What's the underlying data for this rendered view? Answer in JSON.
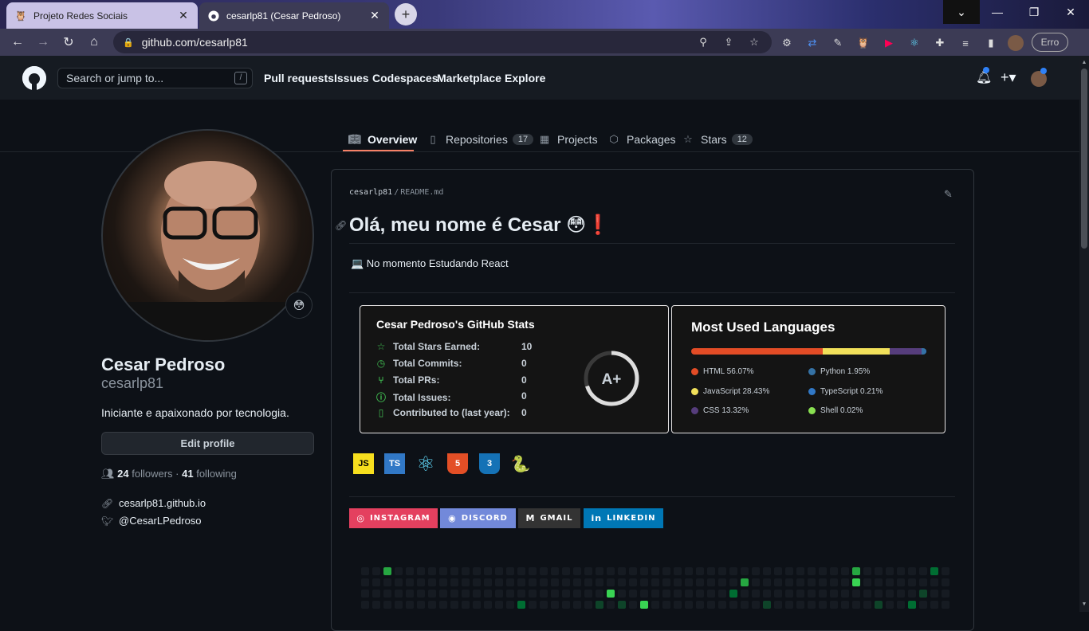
{
  "browser": {
    "tabs": [
      {
        "label": "Projeto Redes Sociais",
        "icon": "owl-icon"
      },
      {
        "label": "cesarlp81 (Cesar Pedroso)",
        "icon": "github-icon"
      }
    ],
    "url": "github.com/cesarlp81",
    "error_label": "Erro"
  },
  "header": {
    "search_placeholder": "Search or jump to...",
    "search_shortcut": "/",
    "nav": [
      "Pull requests",
      "Issues",
      "Codespaces",
      "Marketplace",
      "Explore"
    ]
  },
  "tabs": {
    "overview": "Overview",
    "repositories": "Repositories",
    "repositories_count": "17",
    "projects": "Projects",
    "packages": "Packages",
    "stars": "Stars",
    "stars_count": "12"
  },
  "profile": {
    "name": "Cesar Pedroso",
    "username": "cesarlp81",
    "bio": "Iniciante e apaixonado por tecnologia.",
    "edit_label": "Edit profile",
    "followers_count": "24",
    "followers_label": "followers",
    "separator": "·",
    "following_count": "41",
    "following_label": "following",
    "website": "cesarlp81.github.io",
    "twitter": "@CesarLPedroso"
  },
  "readme": {
    "path_user": "cesarlp81",
    "path_sep": "/",
    "path_file": "README.md",
    "heading": "Olá, meu nome é Cesar 😳❗",
    "now": "💻 No momento Estudando React"
  },
  "stats": {
    "title": "Cesar Pedroso's GitHub Stats",
    "rows": [
      {
        "label": "Total Stars Earned:",
        "value": "10"
      },
      {
        "label": "Total Commits:",
        "value": "0"
      },
      {
        "label": "Total PRs:",
        "value": "0"
      },
      {
        "label": "Total Issues:",
        "value": "0"
      },
      {
        "label": "Contributed to (last year):",
        "value": "0"
      }
    ],
    "grade": "A+",
    "grade_progress": 0.7,
    "accent": "#3fb950"
  },
  "languages": {
    "title": "Most Used Languages",
    "items": [
      {
        "label": "HTML 56.07%",
        "percent": 56.07,
        "color": "#e34c26"
      },
      {
        "label": "JavaScript 28.43%",
        "percent": 28.43,
        "color": "#f1e05a"
      },
      {
        "label": "CSS 13.32%",
        "percent": 13.32,
        "color": "#563d7c"
      },
      {
        "label": "Python 1.95%",
        "percent": 1.95,
        "color": "#3572a5"
      },
      {
        "label": "TypeScript 0.21%",
        "percent": 0.21,
        "color": "#3178c6"
      },
      {
        "label": "Shell 0.02%",
        "percent": 0.02,
        "color": "#89e051"
      }
    ]
  },
  "tech": [
    {
      "label": "JS",
      "icon": "javascript-icon",
      "bg": "#f7df1e",
      "fg": "#000000"
    },
    {
      "label": "TS",
      "icon": "typescript-icon",
      "bg": "#3178c6",
      "fg": "#ffffff"
    },
    {
      "label": "⚛",
      "icon": "react-icon",
      "bg": "transparent",
      "fg": "#61dafb"
    },
    {
      "label": "5",
      "icon": "html5-icon",
      "bg": "#e34f26",
      "fg": "#ffffff"
    },
    {
      "label": "3",
      "icon": "css3-icon",
      "bg": "#1572b6",
      "fg": "#ffffff"
    },
    {
      "label": "🐍",
      "icon": "python-icon",
      "bg": "transparent",
      "fg": "#ffd43b"
    }
  ],
  "badges": [
    {
      "label": "INSTAGRAM",
      "icon": "instagram-icon",
      "color": "#e4405f"
    },
    {
      "label": "DISCORD",
      "icon": "discord-icon",
      "color": "#7289da"
    },
    {
      "label": "GMAIL",
      "icon": "gmail-icon",
      "color": "#333333"
    },
    {
      "label": "LINKEDIN",
      "icon": "linkedin-icon",
      "color": "#0077b5"
    }
  ]
}
